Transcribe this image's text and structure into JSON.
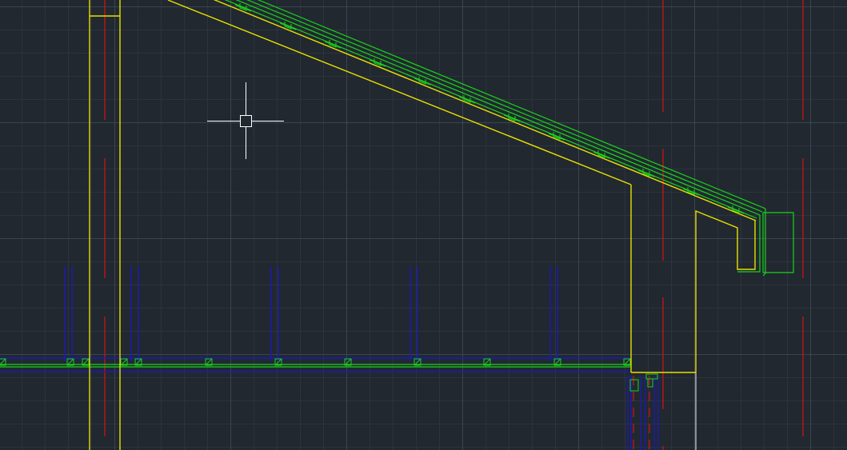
{
  "app": {
    "type": "CAD model space",
    "background_color": "#212830"
  },
  "colors": {
    "structure_outline": "#e8e000",
    "roof_layers": "#19d319",
    "joists_and_studs": "#1a1ab8",
    "centerlines": "#c81414",
    "crosshair": "#ffffff",
    "post": "#c8c8c8"
  },
  "cursor": {
    "style": "crosshair with pickbox"
  }
}
